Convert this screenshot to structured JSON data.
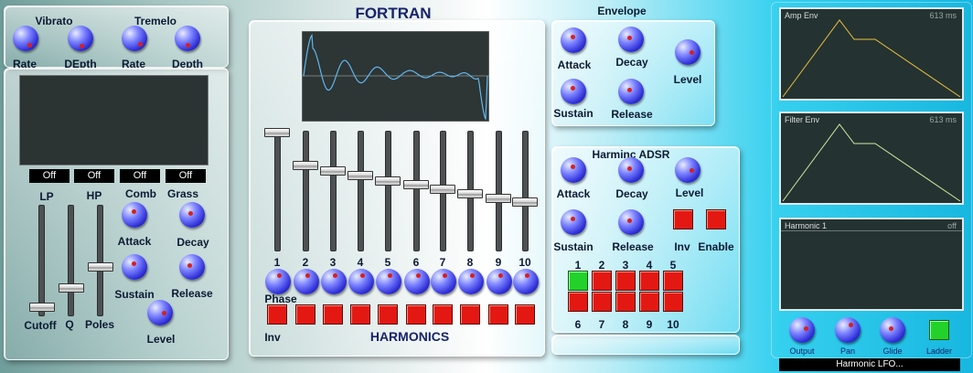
{
  "title": "FORTRAN",
  "vibrato": {
    "label": "Vibrato",
    "rate": "Rate",
    "depth": "DEpth"
  },
  "tremelo": {
    "label": "Tremelo",
    "rate": "Rate",
    "depth": "Depth"
  },
  "filter": {
    "toggles": [
      "Off",
      "Off",
      "Off",
      "Off"
    ],
    "toggle_labels": [
      "LP",
      "HP",
      "Comb",
      "Grass"
    ],
    "slider_labels": [
      "Cutoff",
      "Q",
      "Poles"
    ],
    "knobs": {
      "attack": "Attack",
      "decay": "Decay",
      "sustain": "Sustain",
      "release": "Release",
      "level": "Level"
    }
  },
  "harmonics": {
    "title": "HARMONICS",
    "numbers": [
      "1",
      "2",
      "3",
      "4",
      "5",
      "6",
      "7",
      "8",
      "9",
      "10"
    ],
    "phase_label": "Phase",
    "inv_label": "Inv",
    "slider_levels": [
      0.0,
      0.26,
      0.31,
      0.36,
      0.41,
      0.45,
      0.49,
      0.54,
      0.58,
      0.62
    ]
  },
  "envelope": {
    "title": "Envelope",
    "attack": "Attack",
    "decay": "Decay",
    "level": "Level",
    "sustain": "Sustain",
    "release": "Release"
  },
  "harminc_adsr": {
    "title": "Harminc ADSR",
    "attack": "Attack",
    "decay": "Decay",
    "level": "Level",
    "sustain": "Sustain",
    "release": "Release",
    "inv": "Inv",
    "enable": "Enable",
    "grid_top": [
      "1",
      "2",
      "3",
      "4",
      "5"
    ],
    "grid_bottom": [
      "6",
      "7",
      "8",
      "9",
      "10"
    ]
  },
  "displays": {
    "amp_env": {
      "title": "Amp Env",
      "time": "613 ms"
    },
    "filter_env": {
      "title": "Filter Env",
      "time": "613 ms"
    },
    "harmonic": {
      "title": "Harmonic 1",
      "state": "off"
    }
  },
  "footer": {
    "output": "Output",
    "pan": "Pan",
    "glide": "Glide",
    "ladder": "Ladder",
    "lfo_select": "Harmonic LFO..."
  },
  "colors": {
    "amp_env_line": "#e8c23a",
    "filter_env_line": "#c9f0a0",
    "wave_line": "#5fb7ee",
    "button_on": "#e41812",
    "button_green": "#22d22a"
  }
}
